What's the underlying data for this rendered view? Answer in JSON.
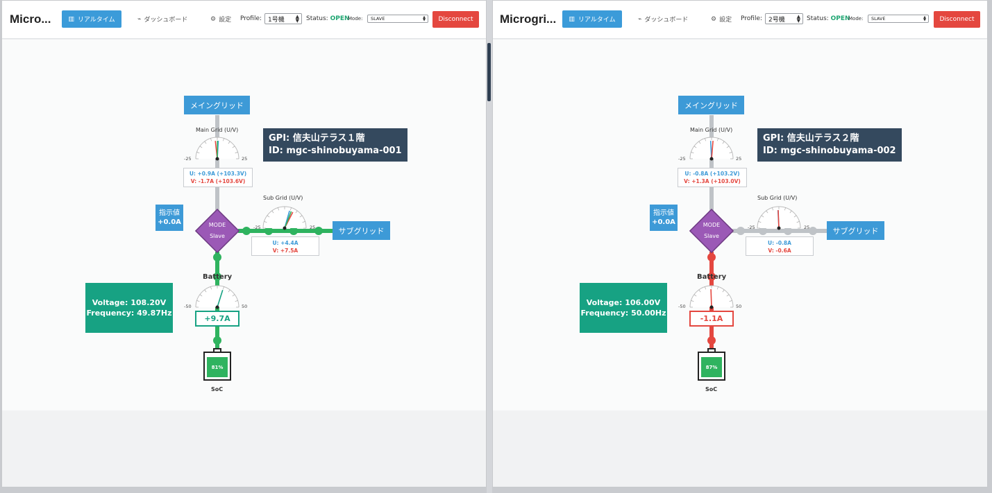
{
  "panes": [
    {
      "title": "Micro...",
      "realtime_label": "リアルタイム",
      "dashboard_label": "ダッシュボード",
      "settings_label": "設定",
      "profile_label": "Profile:",
      "profile_value": "1号機",
      "status_label": "Status:",
      "status_value": "OPEN",
      "mode_label": "Mode:",
      "mode_value": "SLAVE",
      "disconnect_label": "Disconnect",
      "main_grid_tag": "メイングリッド",
      "main_grid_gauge_title": "Main Grid (U/V)",
      "main_grid_scale_min": "-25",
      "main_grid_scale_max": "25",
      "main_grid_u": "U: +0.9A (+103.3V)",
      "main_grid_v": "V: -1.7A (+103.6V)",
      "gpi_line1": "GPI: 信夫山テラス１階",
      "gpi_line2": "ID: mgc-shinobuyama-001",
      "indicator_label": "指示値",
      "indicator_value": "+0.0A",
      "mode_diamond_line1": "MODE",
      "mode_diamond_line2": "Slave",
      "sub_grid_gauge_title": "Sub Grid (U/V)",
      "sub_grid_scale_min": "-25",
      "sub_grid_scale_max": "25",
      "sub_grid_tag": "サブグリッド",
      "sub_grid_u": "U: +4.4A",
      "sub_grid_v": "V: +7.5A",
      "battery_title": "Battery",
      "battery_scale_min": "-50",
      "battery_scale_max": "50",
      "battery_current": "+9.7A",
      "voltage": "Voltage: 108.20V",
      "frequency": "Frequency: 49.87Hz",
      "soc_value": "81%",
      "soc_label": "SoC",
      "colors": {
        "flow_sub": "#2fb35f",
        "flow_batt": "#2fb35f",
        "current_box": "#17a283"
      }
    },
    {
      "title": "Microgri...",
      "realtime_label": "リアルタイム",
      "dashboard_label": "ダッシュボード",
      "settings_label": "設定",
      "profile_label": "Profile:",
      "profile_value": "2号機",
      "status_label": "Status:",
      "status_value": "OPEN",
      "mode_label": "Mode:",
      "mode_value": "SLAVE",
      "disconnect_label": "Disconnect",
      "main_grid_tag": "メイングリッド",
      "main_grid_gauge_title": "Main Grid (U/V)",
      "main_grid_scale_min": "-25",
      "main_grid_scale_max": "25",
      "main_grid_u": "U: -0.8A (+103.2V)",
      "main_grid_v": "V: +1.3A (+103.0V)",
      "gpi_line1": "GPI: 信夫山テラス２階",
      "gpi_line2": "ID: mgc-shinobuyama-002",
      "indicator_label": "指示値",
      "indicator_value": "+0.0A",
      "mode_diamond_line1": "MODE",
      "mode_diamond_line2": "Slave",
      "sub_grid_gauge_title": "Sub Grid (U/V)",
      "sub_grid_scale_min": "-25",
      "sub_grid_scale_max": "25",
      "sub_grid_tag": "サブグリッド",
      "sub_grid_u": "U: -0.8A",
      "sub_grid_v": "V: -0.6A",
      "battery_title": "Battery",
      "battery_scale_min": "-50",
      "battery_scale_max": "50",
      "battery_current": "-1.1A",
      "voltage": "Voltage: 106.00V",
      "frequency": "Frequency: 50.00Hz",
      "soc_value": "87%",
      "soc_label": "SoC",
      "colors": {
        "flow_sub": "#bfc3c7",
        "flow_batt": "#e4473f",
        "current_box": "#e4473f"
      }
    }
  ]
}
